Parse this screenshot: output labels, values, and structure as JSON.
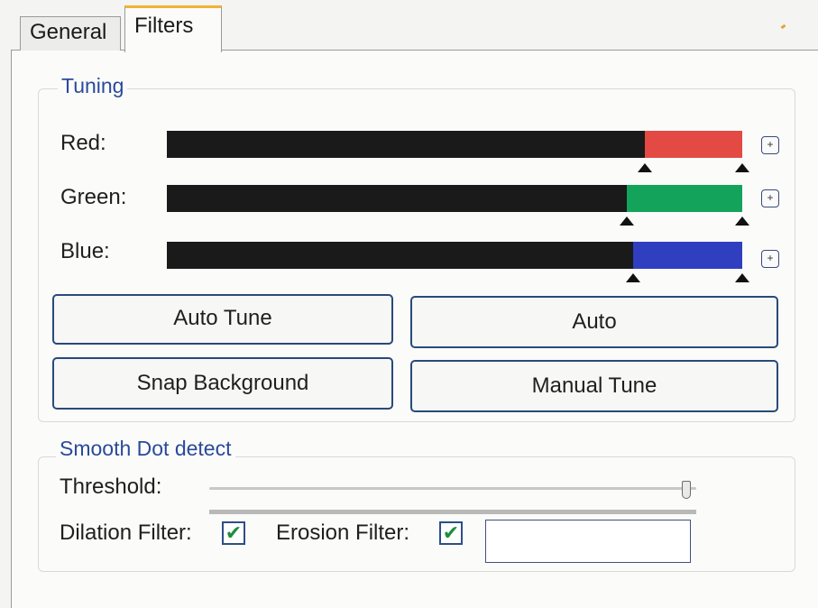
{
  "tabs": [
    {
      "label": "General",
      "selected": false
    },
    {
      "label": "Filters",
      "selected": true
    }
  ],
  "tuning": {
    "title": "Tuning",
    "channels": [
      {
        "label": "Red:",
        "color": "#e24a43",
        "low_fraction": 0.83,
        "high_fraction": 1.0
      },
      {
        "label": "Green:",
        "color": "#13a35b",
        "low_fraction": 0.8,
        "high_fraction": 1.0
      },
      {
        "label": "Blue:",
        "color": "#2f3fc0",
        "low_fraction": 0.81,
        "high_fraction": 1.0
      }
    ],
    "plus_symbol": "+",
    "buttons": {
      "auto_tune": "Auto Tune",
      "auto": "Auto",
      "snap_background": "Snap Background",
      "manual_tune": "Manual Tune"
    }
  },
  "smooth": {
    "title": "Smooth Dot detect",
    "threshold_label": "Threshold:",
    "threshold_value_fraction": 0.98,
    "dilation_label": "Dilation Filter:",
    "dilation_checked": true,
    "erosion_label": "Erosion Filter:",
    "erosion_checked": true,
    "text_value": ""
  },
  "accent_colors": {
    "tab_highlight": "#f3b233",
    "group_title": "#2a4a9a",
    "check": "#1c8f3a"
  }
}
